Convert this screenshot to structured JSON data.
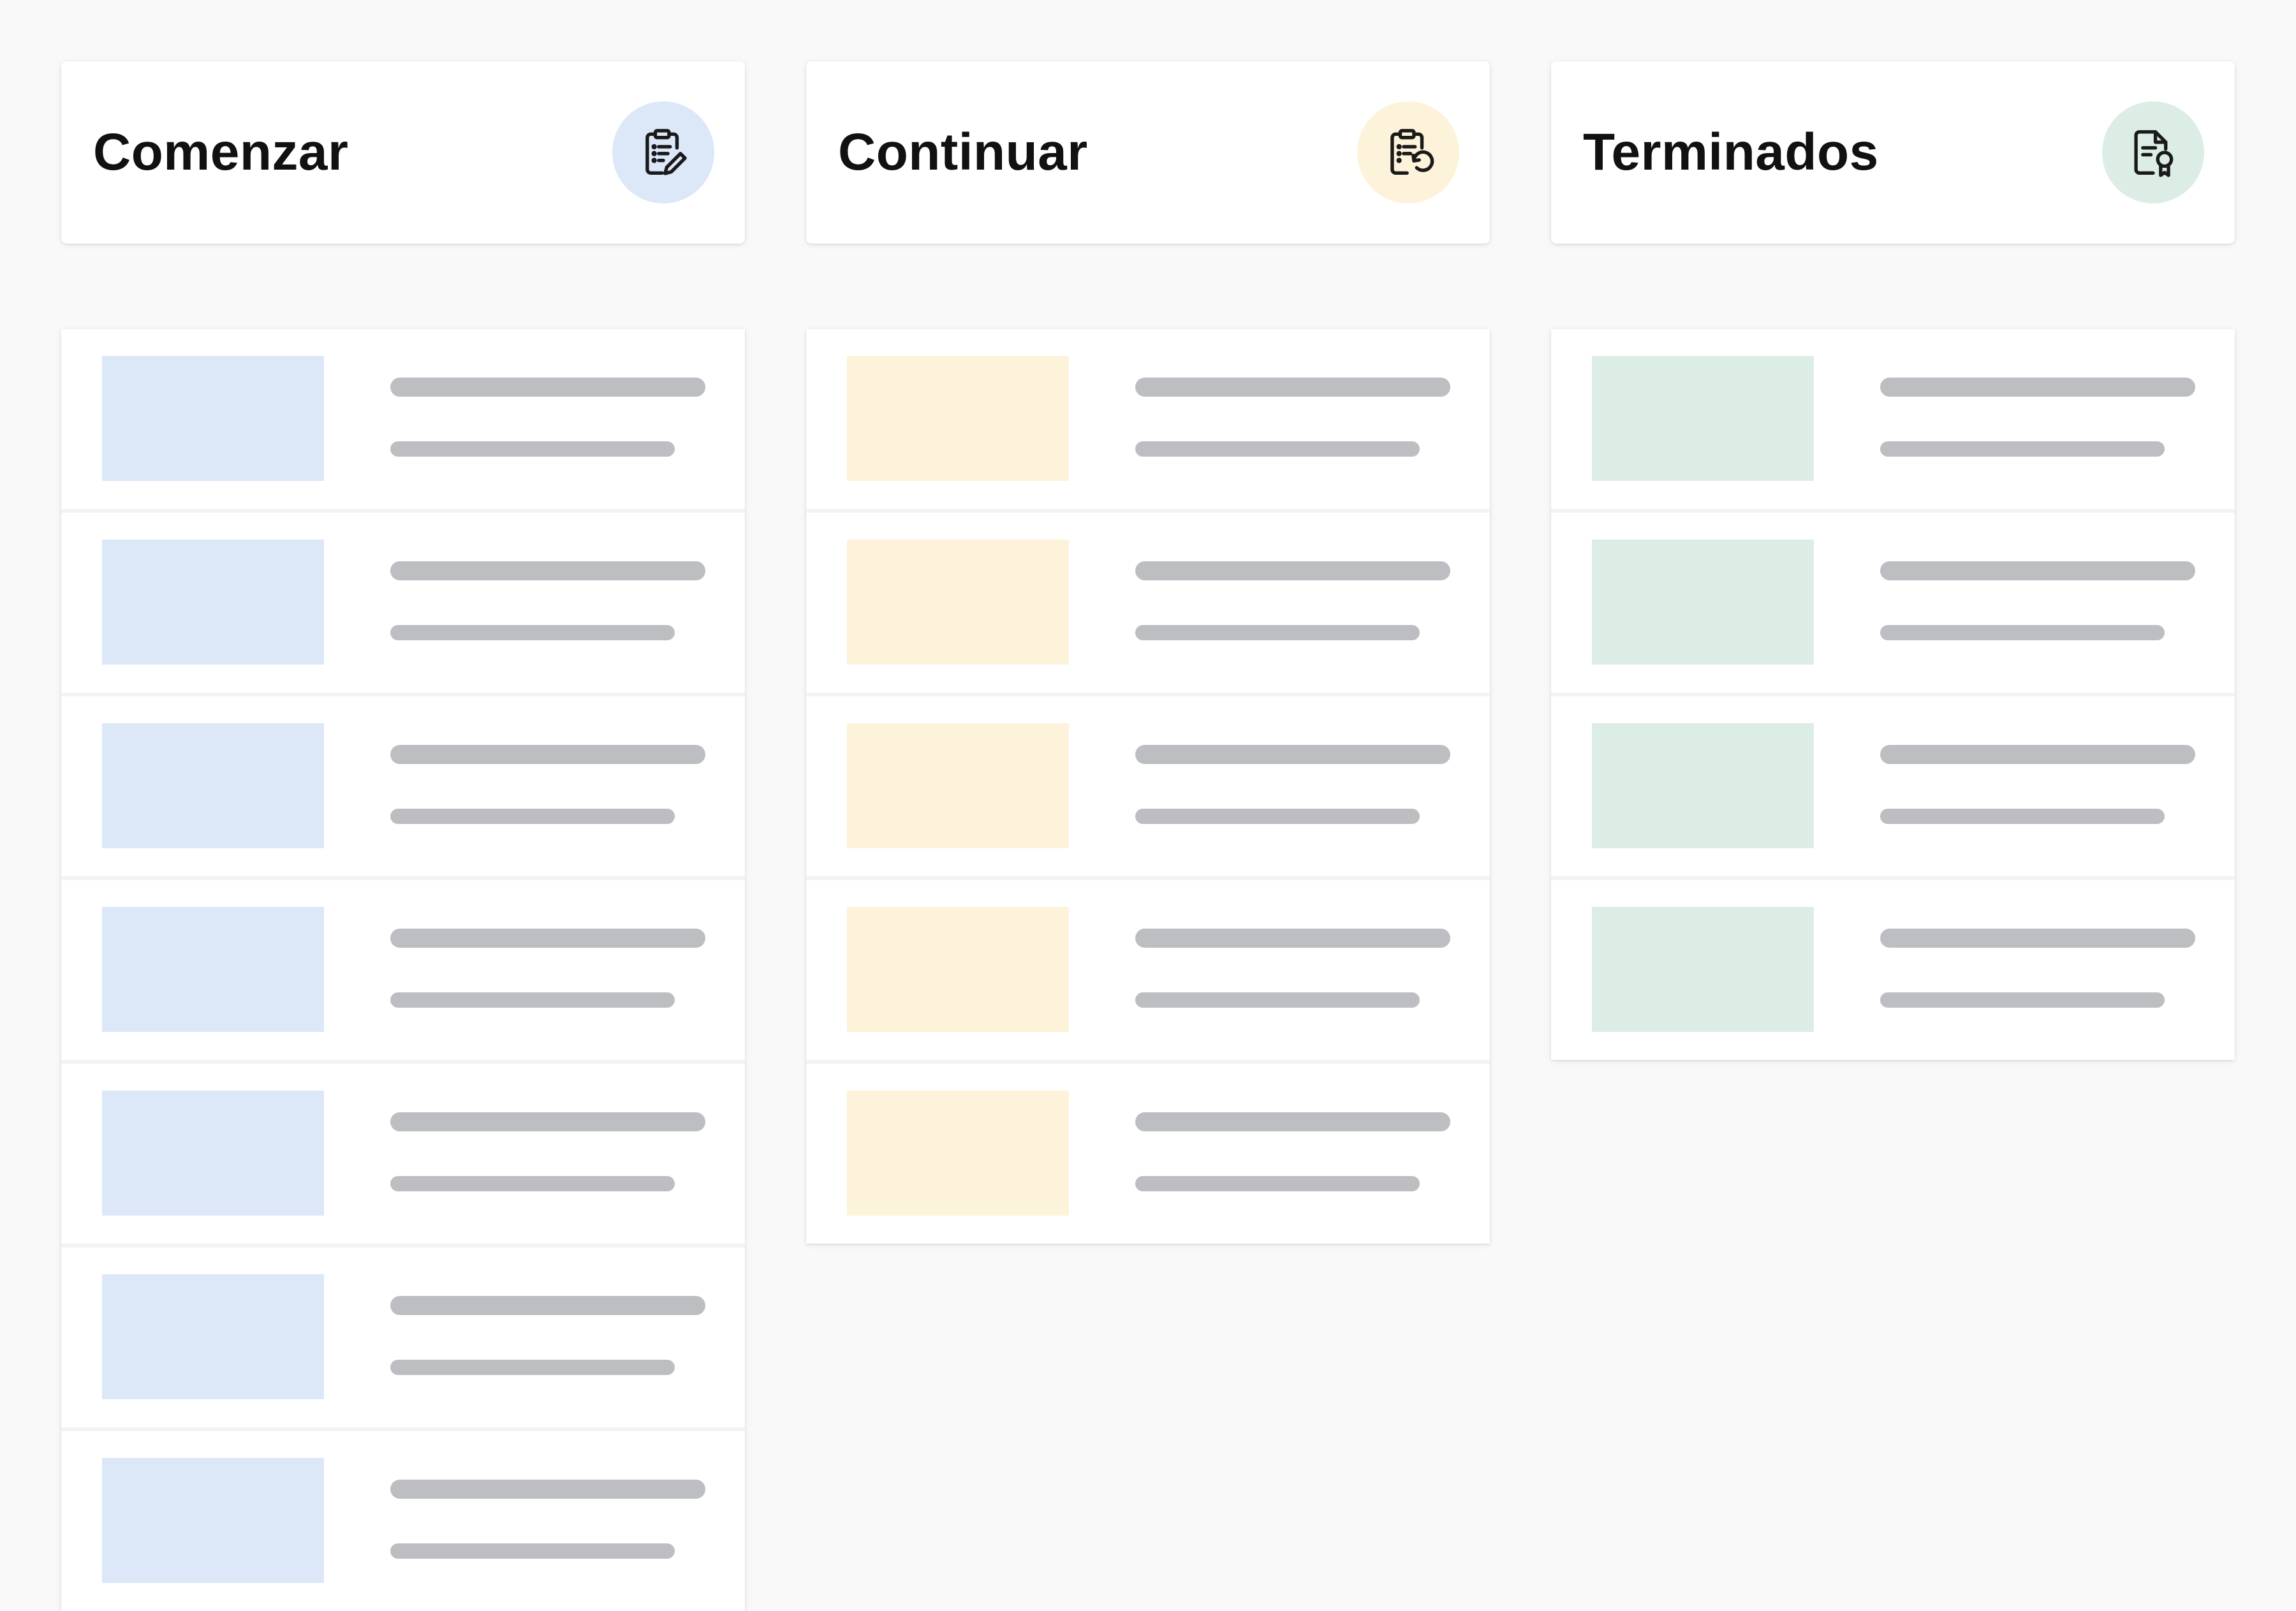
{
  "colors": {
    "background": "#f9f9f9",
    "card": "#ffffff",
    "placeholder_line": "#bdbec1",
    "blue_tint": "#dce7f8",
    "yellow_tint": "#fdf3da",
    "green_tint": "#dbede5"
  },
  "columns": [
    {
      "title": "Comenzar",
      "icon": "clipboard-edit-icon",
      "accent": "#dce7f8",
      "item_count": 7
    },
    {
      "title": "Continuar",
      "icon": "clipboard-undo-icon",
      "accent": "#fdf3da",
      "item_count": 5
    },
    {
      "title": "Terminados",
      "icon": "certificate-icon",
      "accent": "#dbede5",
      "item_count": 4
    }
  ]
}
